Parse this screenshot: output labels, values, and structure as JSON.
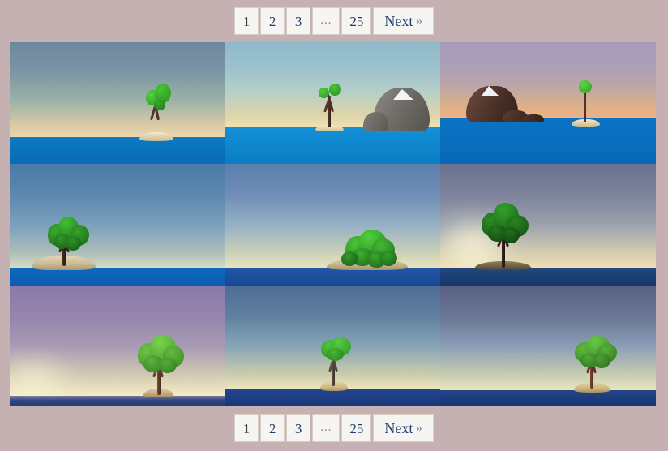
{
  "background_color": "#c5b1b1",
  "pagination": {
    "aria_label": "Pagination",
    "items": [
      {
        "label": "1",
        "state": "current",
        "name": "page-1"
      },
      {
        "label": "2",
        "state": "link",
        "name": "page-2"
      },
      {
        "label": "3",
        "state": "link",
        "name": "page-3"
      },
      {
        "label": "...",
        "state": "disabled",
        "name": "page-ellipsis"
      },
      {
        "label": "25",
        "state": "link",
        "name": "page-25"
      }
    ],
    "next_label": "Next",
    "next_chevron": "»",
    "link_color": "#1f3d73",
    "current_color": "#3a3a3a",
    "disabled_color": "#8a8279",
    "button_background": "#f7f5f2",
    "button_border": "#d8cfcb"
  },
  "gallery": {
    "columns": 3,
    "rows": 3,
    "tiles": [
      {
        "name": "tile-1",
        "alt": "Lone tree on a small sand island at dusk, slate blue sky",
        "sky_top": "#6c87a0",
        "sky_mid": "#8fa9a6",
        "sky_horizon": "#e8d2a8",
        "sea_color": "#0a73bd",
        "sea_height_pct": 22,
        "horizon_glow": "#f0dcb4"
      },
      {
        "name": "tile-2",
        "alt": "Tree on island with snow-capped mountain to the right, teal sky",
        "sky_top": "#8fb9c9",
        "sky_mid": "#a9cbd2",
        "sky_horizon": "#e9d9ab",
        "sea_color": "#0e87cd",
        "sea_height_pct": 30,
        "horizon_glow": "#f2e3b8"
      },
      {
        "name": "tile-3",
        "alt": "Thin palm on island, dark snow-capped mountain left, lavender sky",
        "sky_top": "#a49ab8",
        "sky_mid": "#b3a3b0",
        "sky_horizon": "#e8a97a",
        "sea_color": "#0a6fc0",
        "sea_height_pct": 38,
        "horizon_glow": "#f0b98c"
      },
      {
        "name": "tile-4",
        "alt": "Broad leafy tree on a sandy hill at left, clear blue sky",
        "sky_top": "#4a7ba8",
        "sky_mid": "#7ea3bd",
        "sky_horizon": "#cfd7c8",
        "sea_color": "#0c63b8",
        "sea_height_pct": 14,
        "horizon_glow": "#dfe2ca"
      },
      {
        "name": "tile-5",
        "alt": "Dense cluster of green foliage on a sand island, pale blue sky",
        "sky_top": "#5b7fae",
        "sky_mid": "#91aec6",
        "sky_horizon": "#e4e2bc",
        "sea_color": "#1b4f9e",
        "sea_height_pct": 14,
        "horizon_glow": "#ece8c4"
      },
      {
        "name": "tile-6",
        "alt": "Backlit silhouetted tree on a mound with bright sunset glow",
        "sky_top": "#6b728f",
        "sky_mid": "#9aa2ad",
        "sky_horizon": "#efdfb4",
        "sea_color": "#1c3f73",
        "sea_height_pct": 14,
        "horizon_glow": "#fdf6d8"
      },
      {
        "name": "tile-7",
        "alt": "Tree on the right under a purple mauve sky with cream horizon",
        "sky_top": "#8a7aa8",
        "sky_mid": "#a497b6",
        "sky_horizon": "#f2e7c0",
        "sea_color": "#2e4483",
        "sea_height_pct": 8,
        "horizon_glow": "#f8f0cc"
      },
      {
        "name": "tile-8",
        "alt": "Centered tree with rounded canopy on a sand mound, blue sky",
        "sky_top": "#4d6c96",
        "sky_mid": "#7d9cb8",
        "sky_horizon": "#e8e0b8",
        "sea_color": "#1e3e86",
        "sea_height_pct": 14,
        "horizon_glow": "#f0ebc6"
      },
      {
        "name": "tile-9",
        "alt": "Tree on the right on a sand mound, dusky blue sky",
        "sky_top": "#5a6184",
        "sky_mid": "#8497b4",
        "sky_horizon": "#e6e4bc",
        "sea_color": "#1d3c7e",
        "sea_height_pct": 13,
        "horizon_glow": "#eeeac4"
      }
    ],
    "palette": {
      "sand": "#e7dcb8",
      "sand_shadow": "#c9b98c",
      "trunk": "#5a3a2c",
      "trunk_dark": "#3a2418",
      "leaf_bright": "#3fbf2f",
      "leaf_mid": "#2f9a28",
      "leaf_dark": "#1d6b1c",
      "rock": "#7d7a76",
      "rock_dark": "#4a3a33",
      "snow": "#f2f4f6"
    }
  }
}
